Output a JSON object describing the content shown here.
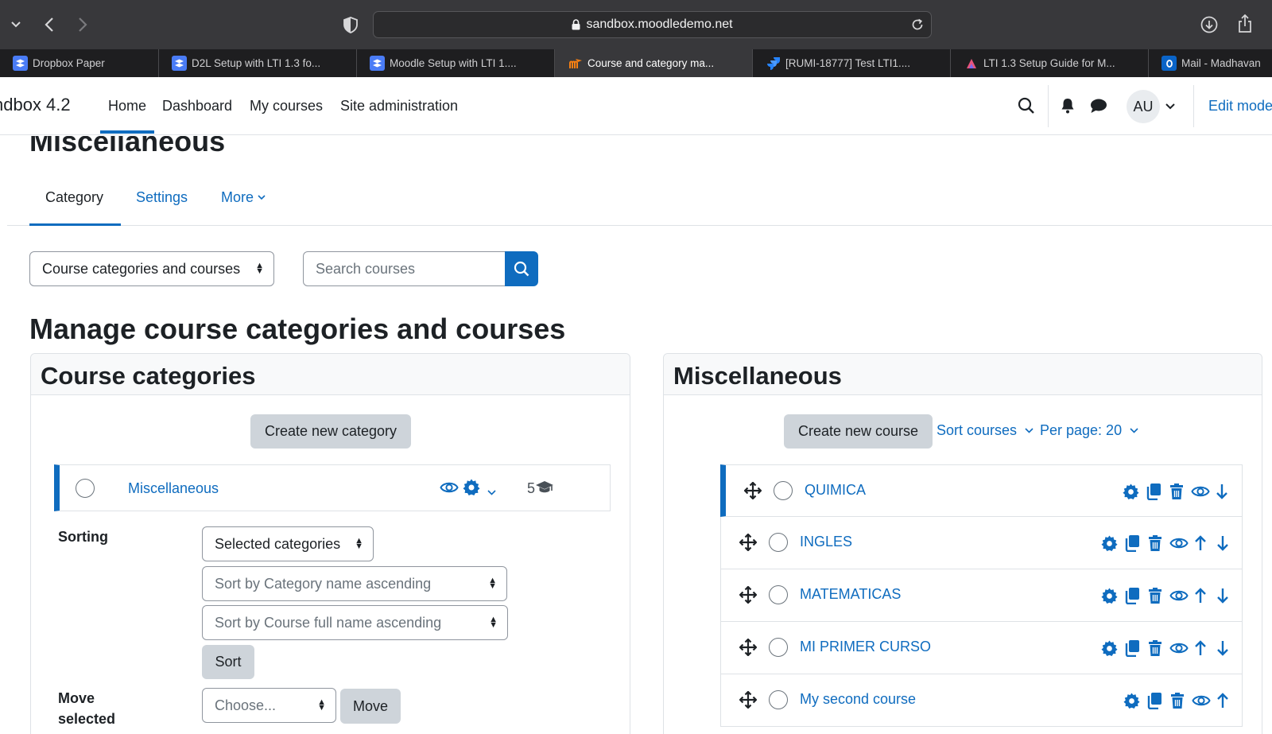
{
  "browser": {
    "url": "sandbox.moodledemo.net",
    "tabs": [
      {
        "label": "Dropbox Paper",
        "icon": "dropbox-icon"
      },
      {
        "label": "D2L Setup with LTI 1.3 fo...",
        "icon": "dropbox-icon"
      },
      {
        "label": "Moodle Setup with LTI 1....",
        "icon": "dropbox-icon"
      },
      {
        "label": "Course and category ma...",
        "icon": "moodle-icon",
        "active": true
      },
      {
        "label": "[RUMI-18777] Test LTI1....",
        "icon": "jira-icon"
      },
      {
        "label": "LTI 1.3 Setup Guide for M...",
        "icon": "clickup-icon"
      },
      {
        "label": "Mail - Madhavan",
        "icon": "outlook-icon"
      }
    ]
  },
  "navbar": {
    "brand": "ndbox 4.2",
    "links": [
      "Home",
      "Dashboard",
      "My courses",
      "Site administration"
    ],
    "avatar": "AU",
    "edit_mode": "Edit mode"
  },
  "page": {
    "title": "Miscellaneous",
    "tabs": {
      "category": "Category",
      "settings": "Settings",
      "more": "More"
    },
    "view_select": "Course categories and courses",
    "search_placeholder": "Search courses",
    "heading": "Manage course categories and courses"
  },
  "categories_panel": {
    "title": "Course categories",
    "create_button": "Create new category",
    "category": {
      "name": "Miscellaneous",
      "course_count": "5"
    },
    "sorting_label": "Sorting",
    "sorting_select": "Selected categories",
    "sort_category_select": "Sort by Category name ascending",
    "sort_course_select": "Sort by Course full name ascending",
    "sort_button": "Sort",
    "move_label_1": "Move",
    "move_label_2": "selected",
    "move_select": "Choose...",
    "move_button": "Move"
  },
  "courses_panel": {
    "title": "Miscellaneous",
    "create_button": "Create new course",
    "sort_courses": "Sort courses",
    "per_page": "Per page: 20",
    "courses": [
      {
        "name": "QUIMICA",
        "actions": [
          "gear",
          "copy",
          "delete",
          "eye",
          "down"
        ]
      },
      {
        "name": "INGLES",
        "actions": [
          "gear",
          "copy",
          "delete",
          "eye",
          "up",
          "down"
        ]
      },
      {
        "name": "MATEMATICAS",
        "actions": [
          "gear",
          "copy",
          "delete",
          "eye",
          "up",
          "down"
        ]
      },
      {
        "name": "MI PRIMER CURSO",
        "actions": [
          "gear",
          "copy",
          "delete",
          "eye",
          "up",
          "down"
        ]
      },
      {
        "name": "My second course",
        "actions": [
          "gear",
          "copy",
          "delete",
          "eye",
          "up"
        ]
      }
    ]
  },
  "colors": {
    "primary": "#0f6cbf",
    "secondary_button": "#ced4da",
    "chrome_dark": "#38383b"
  }
}
